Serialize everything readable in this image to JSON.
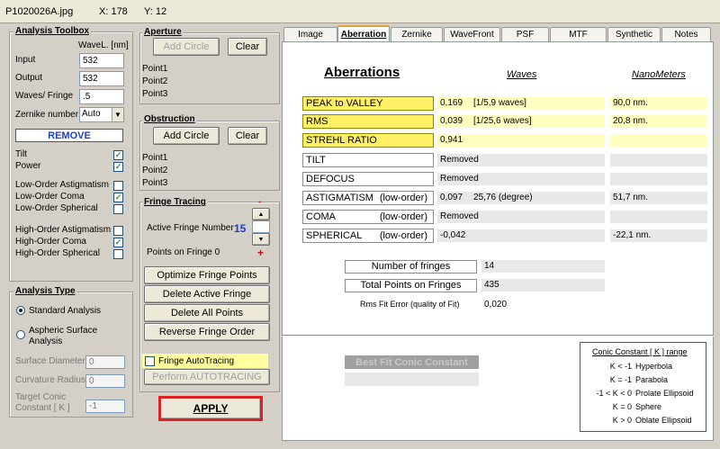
{
  "titlebar": {
    "file": "P1020026A.jpg",
    "x": "X: 178",
    "y": "Y: 12"
  },
  "toolbox": {
    "title": "Analysis Toolbox",
    "wavel_header": "WaveL. [nm]",
    "input_label": "Input",
    "input_value": "532",
    "output_label": "Output",
    "output_value": "532",
    "wpf_label": "Waves/ Fringe",
    "wpf_value": ".5",
    "zernike_label": "Zernike number",
    "zernike_value": "Auto",
    "remove_label": "REMOVE",
    "items": [
      {
        "label": "Tilt",
        "checked": true
      },
      {
        "label": "Power",
        "checked": true
      },
      {
        "label": "Low-Order  Astigmatism",
        "checked": false
      },
      {
        "label": "Low-Order  Coma",
        "checked": true
      },
      {
        "label": "Low-Order  Spherical",
        "checked": false
      },
      {
        "label": "High-Order  Astigmatism",
        "checked": false
      },
      {
        "label": "High-Order  Coma",
        "checked": true
      },
      {
        "label": "High-Order  Spherical",
        "checked": false
      }
    ]
  },
  "analysis_type": {
    "title": "Analysis Type",
    "standard": "Standard Analysis",
    "aspheric": "Aspheric  Surface\nAnalysis",
    "surface_diameter_label": "Surface Diameter",
    "surface_diameter_value": "0",
    "curvature_radius_label": "Curvature Radius",
    "curvature_radius_value": "0",
    "target_conic_label": "Target Conic\nConstant [ K ]",
    "target_conic_value": "-1"
  },
  "aperture": {
    "title": "Aperture",
    "add": "Add Circle",
    "clear": "Clear",
    "points": [
      "Point1",
      "Point2",
      "Point3"
    ]
  },
  "obstruction": {
    "title": "Obstruction",
    "add": "Add Circle",
    "clear": "Clear",
    "points": [
      "Point1",
      "Point2",
      "Point3"
    ]
  },
  "fringe": {
    "title": "Fringe Tracing",
    "active_label": "Active Fringe Number",
    "active_value": "15",
    "minus": "-",
    "plus": "+",
    "points_label": "Points on  Fringe 0",
    "optimize": "Optimize Fringe Points",
    "delete_active": "Delete Active Fringe",
    "delete_all": "Delete  All  Points",
    "reverse": "Reverse  Fringe Order",
    "autotracing": "Fringe AutoTracing",
    "perform": "Perform  AUTOTRACING"
  },
  "apply": "APPLY",
  "tabs": [
    "Image",
    "Aberration",
    "Zernike",
    "WaveFront",
    "PSF",
    "MTF",
    "Synthetic",
    "Notes"
  ],
  "aberr": {
    "title": "Aberrations",
    "waves_header": "Waves",
    "nm_header": "NanoMeters",
    "rows": [
      {
        "name": "PEAK to VALLEY",
        "name2": "",
        "val": "0,169",
        "val2": "[1/5,9 waves]",
        "nm": "90,0  nm.",
        "style": "yel"
      },
      {
        "name": "RMS",
        "name2": "",
        "val": "0,039",
        "val2": "[1/25,6 waves]",
        "nm": "20,8  nm.",
        "style": "yel"
      },
      {
        "name": "STREHL   RATIO",
        "name2": "",
        "val": "0,941",
        "val2": "",
        "nm": "",
        "style": "yel"
      },
      {
        "name": "TILT",
        "name2": "",
        "val": "Removed",
        "val2": "",
        "nm": "",
        "style": "gry"
      },
      {
        "name": "DEFOCUS",
        "name2": "",
        "val": "Removed",
        "val2": "",
        "nm": "",
        "style": "gry"
      },
      {
        "name": "ASTIGMATISM",
        "name2": "(low-order)",
        "val": "0,097",
        "val2": "25,76  (degree)",
        "nm": "51,7  nm.",
        "style": "gry"
      },
      {
        "name": "COMA",
        "name2": "(low-order)",
        "val": "Removed",
        "val2": "",
        "nm": "",
        "style": "gry"
      },
      {
        "name": "SPHERICAL",
        "name2": "(low-order)",
        "val": "-0,042",
        "val2": "",
        "nm": "-22,1  nm.",
        "style": "gry"
      }
    ],
    "num_fringes_label": "Number of fringes",
    "num_fringes": "14",
    "total_points_label": "Total  Points on Fringes",
    "total_points": "435",
    "rms_fit_label": "Rms Fit Error (quality of Fit)",
    "rms_fit": "0,020",
    "best_fit": "Best Fit Conic Constant"
  },
  "conic": {
    "title": "Conic Constant [ K ]  range",
    "rows": [
      {
        "k": "K < -1",
        "name": "Hyperbola"
      },
      {
        "k": "K = -1",
        "name": "Parabola"
      },
      {
        "k": "-1 < K < 0",
        "name": "Prolate Ellipsoid"
      },
      {
        "k": "K =  0",
        "name": "Sphere"
      },
      {
        "k": "K > 0",
        "name": "Oblate Ellipsoid"
      }
    ]
  }
}
